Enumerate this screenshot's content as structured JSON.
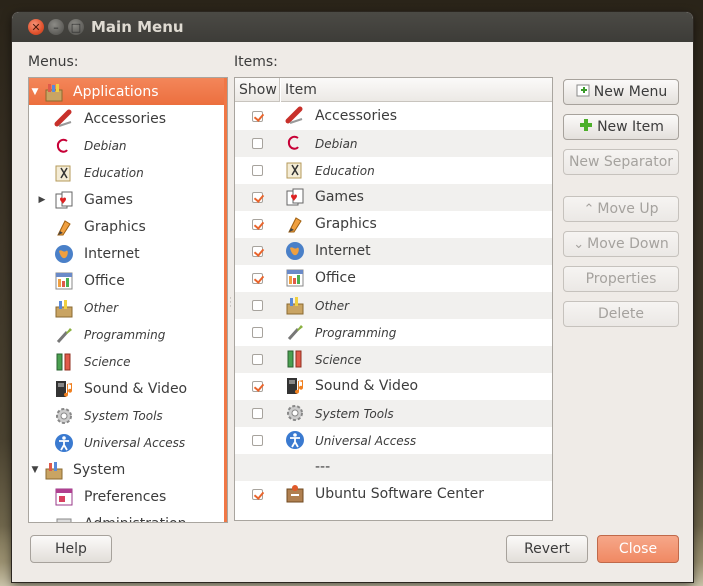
{
  "window": {
    "title": "Main Menu"
  },
  "labels": {
    "menus": "Menus:",
    "items": "Items:"
  },
  "columns": {
    "show": "Show",
    "item": "Item"
  },
  "menus_tree": [
    {
      "label": "Applications",
      "level": 0,
      "expander": "▼",
      "italic": false,
      "selected": true,
      "icon": "applications-icon"
    },
    {
      "label": "Accessories",
      "level": 1,
      "expander": "",
      "italic": false,
      "icon": "accessories-icon"
    },
    {
      "label": "Debian",
      "level": 1,
      "expander": "",
      "italic": true,
      "icon": "debian-icon"
    },
    {
      "label": "Education",
      "level": 1,
      "expander": "",
      "italic": true,
      "icon": "education-icon"
    },
    {
      "label": "Games",
      "level": 1,
      "expander": "▶",
      "italic": false,
      "icon": "games-icon"
    },
    {
      "label": "Graphics",
      "level": 1,
      "expander": "",
      "italic": false,
      "icon": "graphics-icon"
    },
    {
      "label": "Internet",
      "level": 1,
      "expander": "",
      "italic": false,
      "icon": "internet-icon"
    },
    {
      "label": "Office",
      "level": 1,
      "expander": "",
      "italic": false,
      "icon": "office-icon"
    },
    {
      "label": "Other",
      "level": 1,
      "expander": "",
      "italic": true,
      "icon": "other-icon"
    },
    {
      "label": "Programming",
      "level": 1,
      "expander": "",
      "italic": true,
      "icon": "programming-icon"
    },
    {
      "label": "Science",
      "level": 1,
      "expander": "",
      "italic": true,
      "icon": "science-icon"
    },
    {
      "label": "Sound & Video",
      "level": 1,
      "expander": "",
      "italic": false,
      "icon": "sound-video-icon"
    },
    {
      "label": "System Tools",
      "level": 1,
      "expander": "",
      "italic": true,
      "icon": "system-tools-icon"
    },
    {
      "label": "Universal Access",
      "level": 1,
      "expander": "",
      "italic": true,
      "icon": "universal-access-icon"
    },
    {
      "label": "System",
      "level": 0,
      "expander": "▼",
      "italic": false,
      "icon": "system-icon"
    },
    {
      "label": "Preferences",
      "level": 1,
      "expander": "",
      "italic": false,
      "icon": "preferences-icon"
    },
    {
      "label": "Administration",
      "level": 1,
      "expander": "",
      "italic": false,
      "icon": "administration-icon"
    }
  ],
  "items": [
    {
      "name": "Accessories",
      "show": true,
      "italic": false,
      "icon": "accessories-icon"
    },
    {
      "name": "Debian",
      "show": false,
      "italic": true,
      "icon": "debian-icon"
    },
    {
      "name": "Education",
      "show": false,
      "italic": true,
      "icon": "education-icon"
    },
    {
      "name": "Games",
      "show": true,
      "italic": false,
      "icon": "games-icon"
    },
    {
      "name": "Graphics",
      "show": true,
      "italic": false,
      "icon": "graphics-icon"
    },
    {
      "name": "Internet",
      "show": true,
      "italic": false,
      "icon": "internet-icon"
    },
    {
      "name": "Office",
      "show": true,
      "italic": false,
      "icon": "office-icon"
    },
    {
      "name": "Other",
      "show": false,
      "italic": true,
      "icon": "other-icon"
    },
    {
      "name": "Programming",
      "show": false,
      "italic": true,
      "icon": "programming-icon"
    },
    {
      "name": "Science",
      "show": false,
      "italic": true,
      "icon": "science-icon"
    },
    {
      "name": "Sound & Video",
      "show": true,
      "italic": false,
      "icon": "sound-video-icon"
    },
    {
      "name": "System Tools",
      "show": false,
      "italic": true,
      "icon": "system-tools-icon"
    },
    {
      "name": "Universal Access",
      "show": false,
      "italic": true,
      "icon": "universal-access-icon"
    },
    {
      "name": "---",
      "show": null,
      "italic": false,
      "icon": "",
      "separator": true
    },
    {
      "name": "Ubuntu Software Center",
      "show": true,
      "italic": false,
      "icon": "software-center-icon"
    }
  ],
  "buttons": {
    "new_menu": "New Menu",
    "new_item": "New Item",
    "new_separator": "New Separator",
    "move_up": "Move Up",
    "move_down": "Move Down",
    "properties": "Properties",
    "delete": "Delete",
    "help": "Help",
    "revert": "Revert",
    "close": "Close"
  },
  "colors": {
    "accent": "#f07746",
    "titlebar": "#3d3c38",
    "window_bg": "#efebe7"
  }
}
